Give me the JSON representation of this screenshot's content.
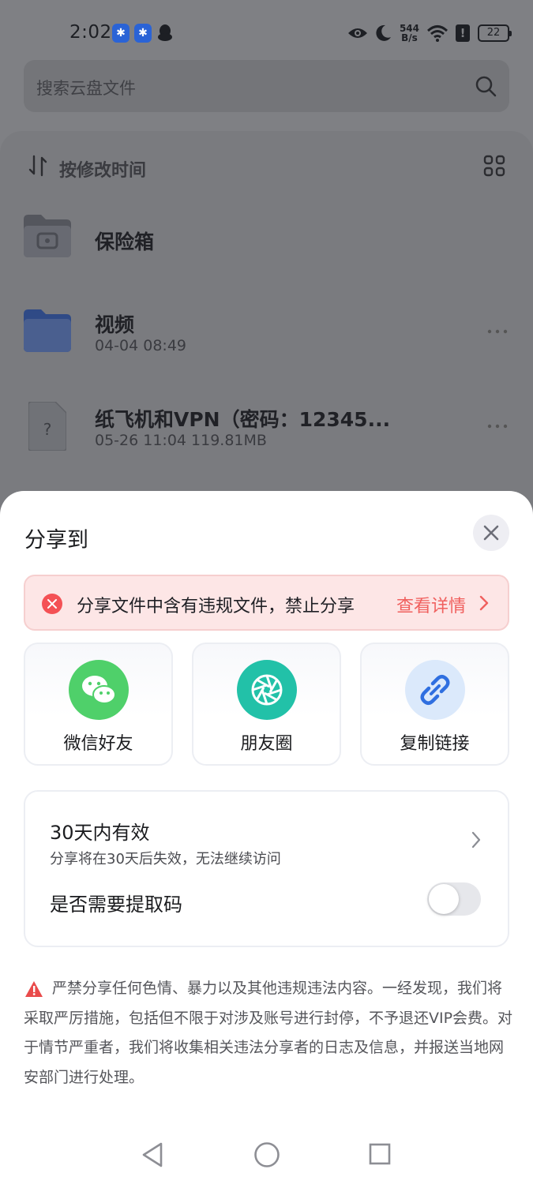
{
  "status_bar": {
    "time": "2:02",
    "net_speed_value": "544",
    "net_speed_unit": "B/s",
    "battery": "22"
  },
  "search": {
    "placeholder": "搜索云盘文件"
  },
  "sort": {
    "label": "按修改时间"
  },
  "files": [
    {
      "name": "保险箱",
      "meta": "",
      "type": "vault-folder"
    },
    {
      "name": "视频",
      "meta": "04-04 08:49",
      "type": "folder"
    },
    {
      "name": "纸飞机和VPN（密码：12345...",
      "meta": "05-26 11:04   119.81MB",
      "type": "unknown-file"
    }
  ],
  "share_sheet": {
    "title": "分享到",
    "warning": {
      "text": "分享文件中含有违规文件，禁止分享",
      "link": "查看详情"
    },
    "targets": [
      {
        "label": "微信好友",
        "icon": "wechat-icon",
        "color": "#4fd06a"
      },
      {
        "label": "朋友圈",
        "icon": "moments-icon",
        "color": "#22c1a8"
      },
      {
        "label": "复制链接",
        "icon": "link-icon",
        "color": "#dbe9fb"
      }
    ],
    "validity": {
      "title": "30天内有效",
      "desc": "分享将在30天后失效，无法继续访问"
    },
    "extract_code": {
      "label": "是否需要提取码",
      "enabled": false
    },
    "notice": "严禁分享任何色情、暴力以及其他违规违法内容。一经发现，我们将采取严厉措施，包括但不限于对涉及账号进行封停，不予退还VIP会费。对于情节严重者，我们将收集相关违法分享者的日志及信息，并报送当地网安部门进行处理。"
  },
  "colors": {
    "accent_red": "#f0605e",
    "overlay": "#7f8084"
  }
}
